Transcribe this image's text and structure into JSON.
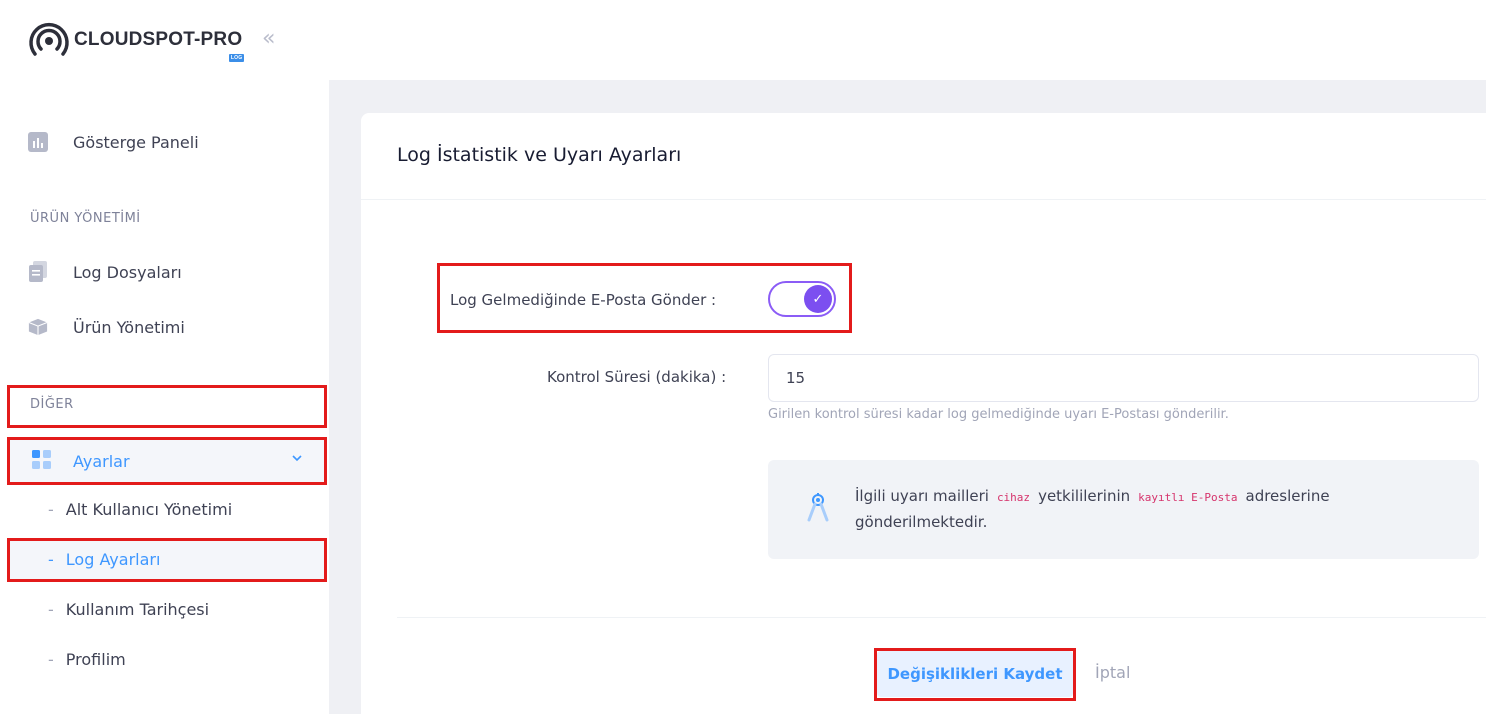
{
  "brand": {
    "name": "CLOUDSPOT-PRO",
    "badge": "LOG"
  },
  "sidebar": {
    "dashboard": "Gösterge Paneli",
    "section_product": "ÜRÜN YÖNETİMİ",
    "log_files": "Log Dosyaları",
    "product_mgmt": "Ürün Yönetimi",
    "section_other": "DİĞER",
    "settings": "Ayarlar",
    "sub_items": [
      "Alt Kullanıcı Yönetimi",
      "Log Ayarları",
      "Kullanım Tarihçesi",
      "Profilim"
    ],
    "dash": "-"
  },
  "card": {
    "title": "Log İstatistik ve Uyarı Ayarları",
    "email_toggle_label": "Log Gelmediğinde E-Posta Gönder :",
    "email_toggle_on": true,
    "interval_label": "Kontrol Süresi (dakika) :",
    "interval_value": "15",
    "interval_help": "Girilen kontrol süresi kadar log gelmediğinde uyarı E-Postası gönderilir.",
    "notice": {
      "part1": "İlgili uyarı mailleri",
      "code1": "cihaz",
      "part2": "yetkililerinin",
      "code2": "kayıtlı E-Posta",
      "part3": "adreslerine gönderilmektedir."
    },
    "save_label": "Değişiklikleri Kaydet",
    "cancel_label": "İptal"
  },
  "colors": {
    "accent": "#3e97ff",
    "toggle": "#7c4ff0",
    "highlight": "#e31b1b"
  }
}
